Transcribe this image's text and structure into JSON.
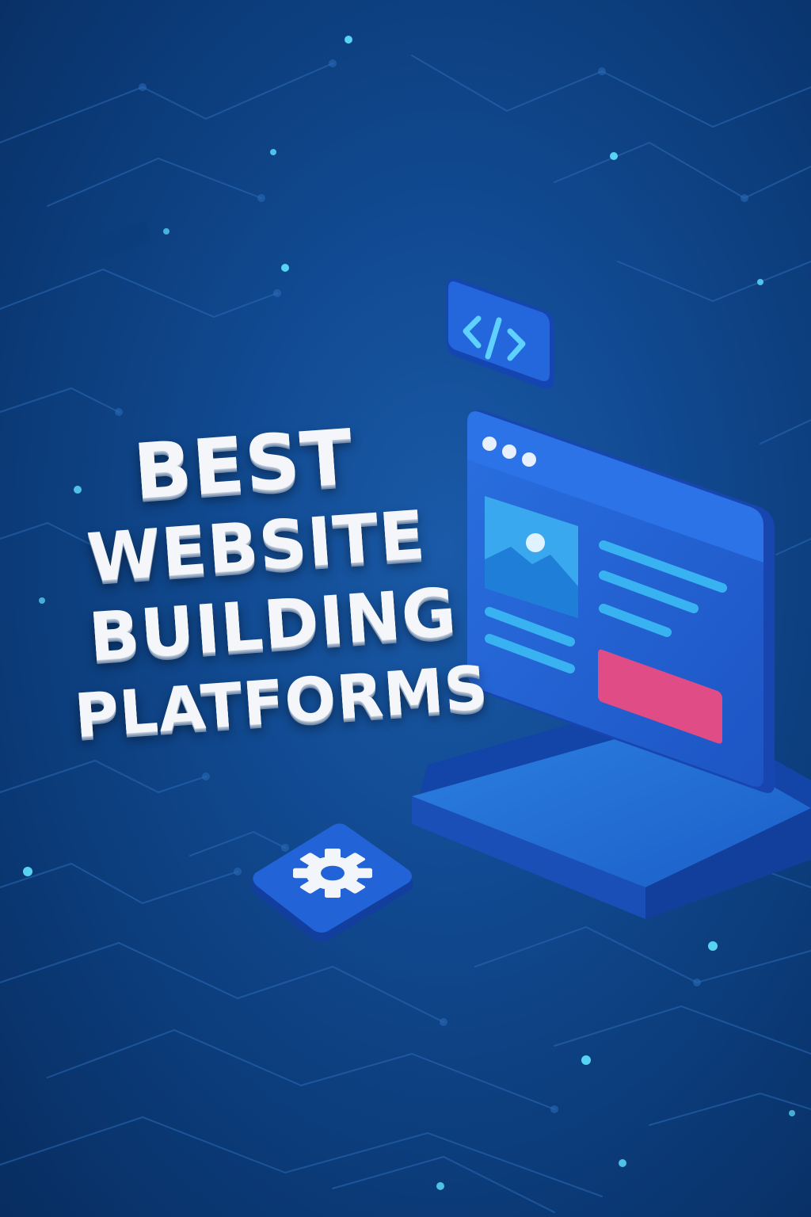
{
  "headline": {
    "line1": "BEST",
    "line2": "WEBSITE",
    "line3": "BUILDING",
    "line4": "PLATFORMS"
  },
  "icons": {
    "code": "code-brackets-icon",
    "gear": "gear-icon",
    "image": "image-placeholder-icon"
  },
  "colors": {
    "background": "#0b3b78",
    "panel_blue": "#1f5fd0",
    "accent_cyan": "#2fb7f0",
    "button_pink": "#e04d86",
    "text_white": "#f4f6f9"
  }
}
